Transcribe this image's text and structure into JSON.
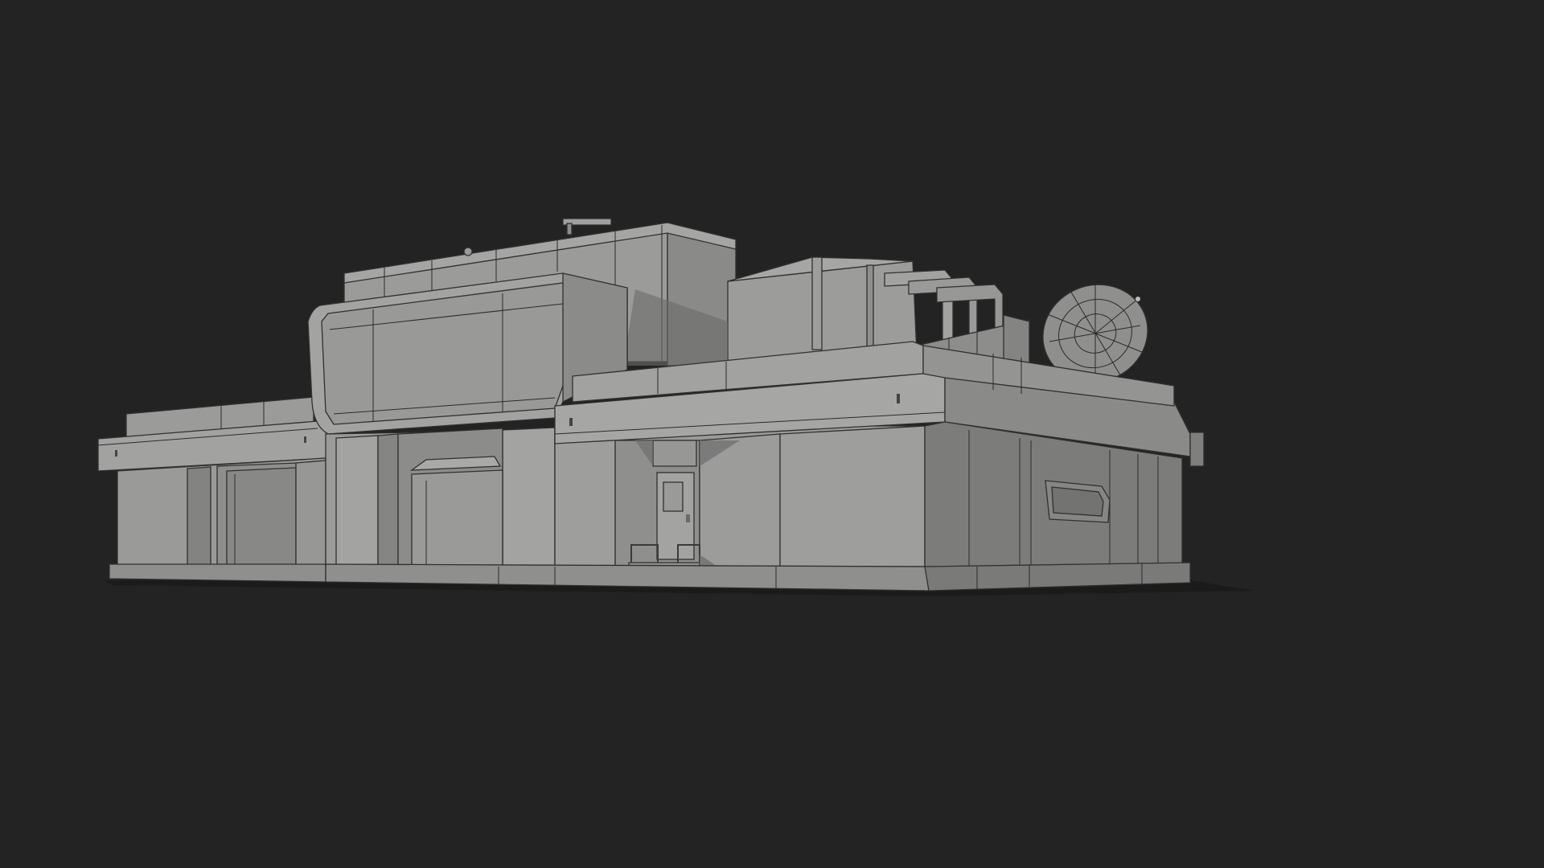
{
  "scene": {
    "subject": "",
    "colors": {
      "background": "#232323",
      "ground": "#1e1e1e",
      "surface_light": "#9a9a98",
      "surface_mid": "#8c8c8a",
      "surface_dark": "#77777a",
      "shadow": "#5f5f5f",
      "wireframe": "#2c2c2c"
    }
  }
}
